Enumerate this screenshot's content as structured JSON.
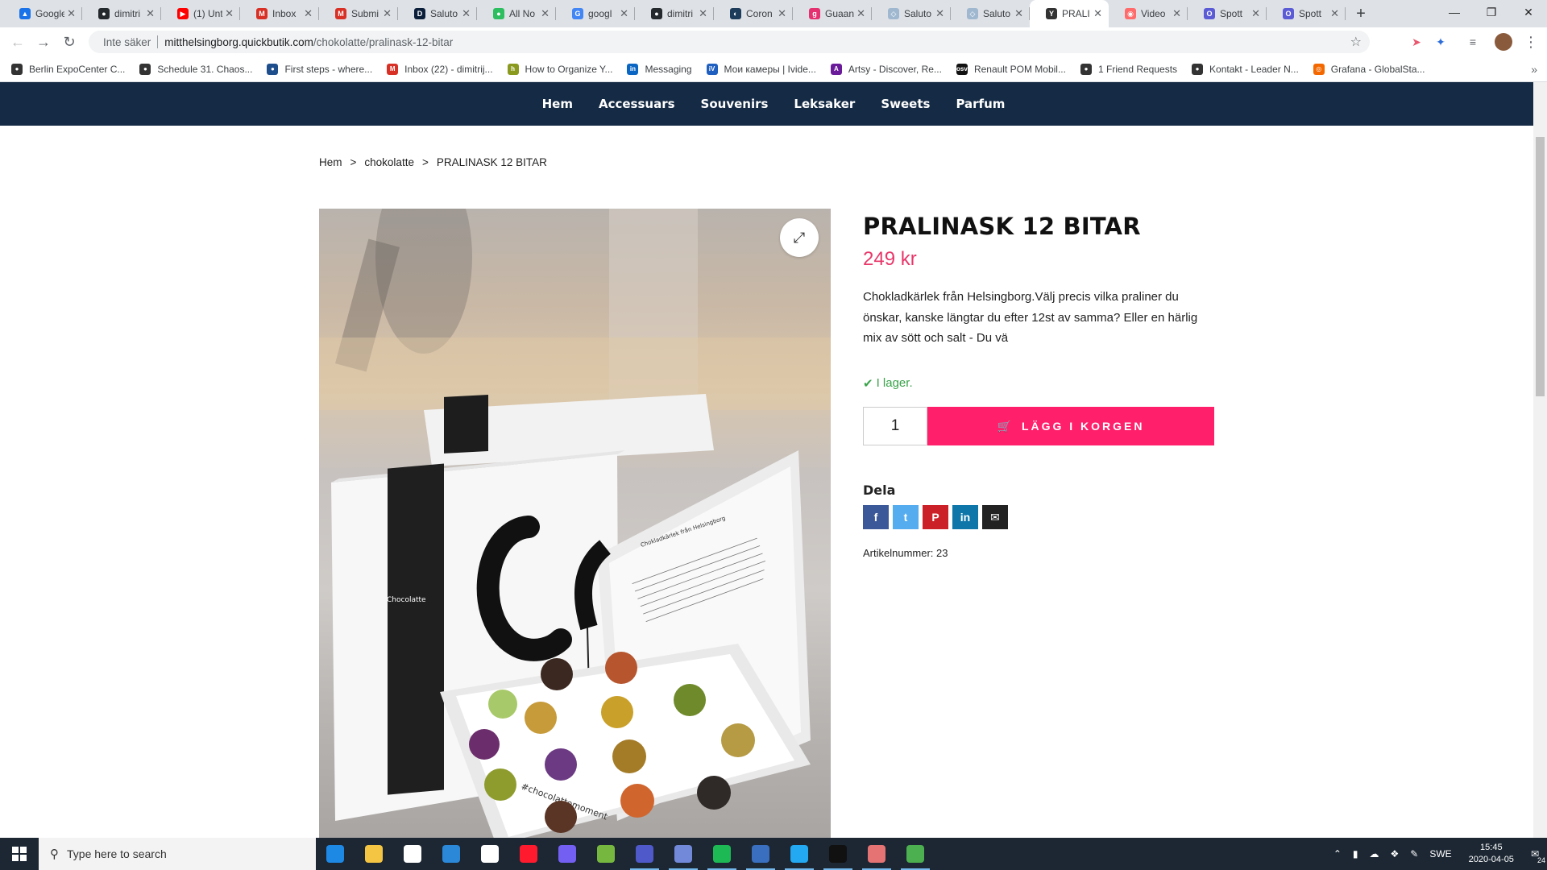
{
  "browser": {
    "tabs": [
      {
        "title": "Google",
        "fav_color": "#1a73e8",
        "fav_glyph": "▲"
      },
      {
        "title": "dimitri",
        "fav_color": "#24292e",
        "fav_glyph": "●"
      },
      {
        "title": "(1) Unt",
        "fav_color": "#ff0000",
        "fav_glyph": "▶"
      },
      {
        "title": "Inbox",
        "fav_color": "#d93025",
        "fav_glyph": "M"
      },
      {
        "title": "Submi",
        "fav_color": "#d93025",
        "fav_glyph": "M"
      },
      {
        "title": "Saluto",
        "fav_color": "#0b1f3a",
        "fav_glyph": "D"
      },
      {
        "title": "All No",
        "fav_color": "#2dbe60",
        "fav_glyph": "●"
      },
      {
        "title": "googl",
        "fav_color": "#4285f4",
        "fav_glyph": "G"
      },
      {
        "title": "dimitri",
        "fav_color": "#24292e",
        "fav_glyph": "●"
      },
      {
        "title": "Coron",
        "fav_color": "#1d3b5a",
        "fav_glyph": "◐"
      },
      {
        "title": "Guaan",
        "fav_color": "#e53170",
        "fav_glyph": "g"
      },
      {
        "title": "Saluto",
        "fav_color": "#9fb8d0",
        "fav_glyph": "◇"
      },
      {
        "title": "Saluto",
        "fav_color": "#9fb8d0",
        "fav_glyph": "◇"
      },
      {
        "title": "PRALI",
        "fav_color": "#333333",
        "fav_glyph": "Y"
      },
      {
        "title": "Video",
        "fav_color": "#ff6b6b",
        "fav_glyph": "◉"
      },
      {
        "title": "Spott",
        "fav_color": "#5b5bd6",
        "fav_glyph": "O"
      },
      {
        "title": "Spott",
        "fav_color": "#5b5bd6",
        "fav_glyph": "O"
      }
    ],
    "active_tab_index": 13,
    "security_label": "Inte säker",
    "url_host": "mitthelsingborg.quickbutik.com",
    "url_path": "/chokolatte/pralinask-12-bitar"
  },
  "bookmarks": [
    {
      "label": "Berlin ExpoCenter C...",
      "color": "#333333",
      "glyph": "●"
    },
    {
      "label": "Schedule 31. Chaos...",
      "color": "#333333",
      "glyph": "●"
    },
    {
      "label": "First steps - where...",
      "color": "#1f4e8c",
      "glyph": "●"
    },
    {
      "label": "Inbox (22) - dimitrij...",
      "color": "#d93025",
      "glyph": "M"
    },
    {
      "label": "How to Organize Y...",
      "color": "#8a9a1f",
      "glyph": "h"
    },
    {
      "label": "Messaging",
      "color": "#0a66c2",
      "glyph": "in"
    },
    {
      "label": "Мои камеры | Ivide...",
      "color": "#1f5fbf",
      "glyph": "iV"
    },
    {
      "label": "Artsy - Discover, Re...",
      "color": "#6a1b9a",
      "glyph": "A"
    },
    {
      "label": "Renault POM Mobil...",
      "color": "#111111",
      "glyph": "osv"
    },
    {
      "label": "1 Friend Requests",
      "color": "#333333",
      "glyph": "●"
    },
    {
      "label": "Kontakt - Leader N...",
      "color": "#333333",
      "glyph": "●"
    },
    {
      "label": "Grafana - GlobalSta...",
      "color": "#f46800",
      "glyph": "◎"
    }
  ],
  "site": {
    "nav": [
      "Hem",
      "Accessuars",
      "Souvenirs",
      "Leksaker",
      "Sweets",
      "Parfum"
    ],
    "breadcrumb": [
      "Hem",
      ">",
      "chokolatte",
      ">",
      "PRALINASK 12 BITAR"
    ],
    "product": {
      "title": "PRALINASK 12 BITAR",
      "price": "249 kr",
      "description": "Chokladkärlek från Helsingborg.Välj precis vilka praliner du önskar, kanske längtar du efter 12st av samma? Eller en härlig mix av sött och salt - Du vä",
      "stock": "I lager.",
      "quantity": "1",
      "add_to_cart": "LÄGG I KORGEN",
      "share_heading": "Dela",
      "article_number": "Artikelnummer: 23",
      "box_brand": "Chocolatte",
      "box_hashtag": "#chocolattemoment",
      "box_lid_heading": "Chokladkärlek från Helsingborg"
    },
    "share_buttons": [
      {
        "name": "facebook",
        "glyph": "f",
        "color": "#3b5998"
      },
      {
        "name": "twitter",
        "glyph": "t",
        "color": "#55acee"
      },
      {
        "name": "pinterest",
        "glyph": "P",
        "color": "#cb2027"
      },
      {
        "name": "linkedin",
        "glyph": "in",
        "color": "#0e76a8"
      },
      {
        "name": "email",
        "glyph": "✉",
        "color": "#222222"
      }
    ]
  },
  "taskbar": {
    "search_placeholder": "Type here to search",
    "apps": [
      {
        "name": "edge",
        "color": "#1e88e5",
        "running": false
      },
      {
        "name": "file-explorer",
        "color": "#f4c542",
        "running": false
      },
      {
        "name": "store",
        "color": "#ffffff",
        "running": false
      },
      {
        "name": "mail",
        "color": "#2b88d8",
        "running": false
      },
      {
        "name": "notepad",
        "color": "#ffffff",
        "running": false
      },
      {
        "name": "opera",
        "color": "#ff1b2d",
        "running": false
      },
      {
        "name": "viber",
        "color": "#7360f2",
        "running": false
      },
      {
        "name": "utorrent",
        "color": "#76b83f",
        "running": false
      },
      {
        "name": "teams",
        "color": "#5059c9",
        "running": true
      },
      {
        "name": "discord",
        "color": "#7289da",
        "running": true
      },
      {
        "name": "spotify",
        "color": "#1db954",
        "running": true
      },
      {
        "name": "save",
        "color": "#3a6fbf",
        "running": true
      },
      {
        "name": "vscode",
        "color": "#23a9f2",
        "running": true
      },
      {
        "name": "terminal",
        "color": "#111111",
        "running": true
      },
      {
        "name": "chrome-badge",
        "color": "#e57373",
        "running": true
      },
      {
        "name": "chrome",
        "color": "#4caf50",
        "running": true
      }
    ],
    "language": "SWE",
    "time": "15:45",
    "date": "2020-04-05",
    "notification_count": "24"
  }
}
